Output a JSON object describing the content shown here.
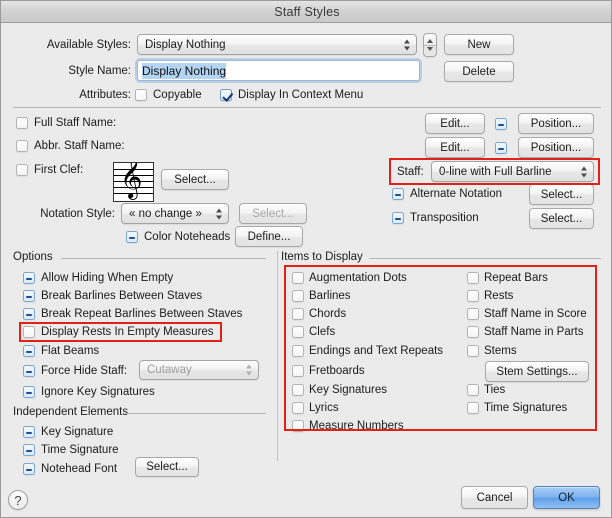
{
  "window": {
    "title": "Staff Styles"
  },
  "top": {
    "available_styles_label": "Available Styles:",
    "available_styles_value": "Display Nothing",
    "style_name_label": "Style Name:",
    "style_name_value": "Display Nothing",
    "attributes_label": "Attributes:",
    "copyable_label": "Copyable",
    "copyable_state": "off",
    "context_menu_label": "Display In Context Menu",
    "context_menu_state": "checked",
    "new_button": "New",
    "delete_button": "Delete",
    "stepper_name": "available-styles-stepper"
  },
  "staffinfo": {
    "full_staff_name_label": "Full Staff Name:",
    "full_staff_name_state": "off",
    "abbr_staff_name_label": "Abbr. Staff Name:",
    "abbr_staff_name_state": "off",
    "first_clef_label": "First Clef:",
    "first_clef_state": "off",
    "clef_glyph": "treble-clef",
    "clef_select_button": "Select...",
    "notation_style_label": "Notation Style:",
    "notation_style_value": "« no change »",
    "notation_select_button": "Select...",
    "color_noteheads_label": "Color Noteheads",
    "color_noteheads_state": "mixed",
    "define_button": "Define...",
    "edit_button_1": "Edit...",
    "position_button_1": "Position...",
    "edit_mixed_1": "mixed",
    "edit_button_2": "Edit...",
    "position_button_2": "Position...",
    "edit_mixed_2": "mixed",
    "staff_label": "Staff:",
    "staff_value": "0-line with Full Barline",
    "alternate_notation_label": "Alternate Notation",
    "alternate_notation_state": "mixed",
    "alternate_notation_button": "Select...",
    "transposition_label": "Transposition",
    "transposition_state": "mixed",
    "transposition_button": "Select..."
  },
  "options": {
    "group_label": "Options",
    "items": [
      {
        "label": "Allow Hiding When Empty",
        "state": "mixed"
      },
      {
        "label": "Break Barlines Between Staves",
        "state": "mixed"
      },
      {
        "label": "Break Repeat Barlines Between Staves",
        "state": "mixed"
      },
      {
        "label": "Display Rests In Empty Measures",
        "state": "off"
      },
      {
        "label": "Flat Beams",
        "state": "mixed"
      },
      {
        "label": "Force Hide Staff:",
        "state": "mixed"
      },
      {
        "label": "Ignore Key Signatures",
        "state": "mixed"
      }
    ],
    "force_hide_value": "Cutaway",
    "force_hide_disabled": true
  },
  "independent": {
    "group_label": "Independent Elements",
    "items": [
      {
        "label": "Key Signature",
        "state": "mixed"
      },
      {
        "label": "Time Signature",
        "state": "mixed"
      },
      {
        "label": "Notehead Font",
        "state": "mixed"
      }
    ],
    "notehead_select_button": "Select..."
  },
  "items_to_display": {
    "group_label": "Items to Display",
    "left_column": [
      {
        "label": "Augmentation Dots",
        "state": "off"
      },
      {
        "label": "Barlines",
        "state": "off"
      },
      {
        "label": "Chords",
        "state": "off"
      },
      {
        "label": "Clefs",
        "state": "off"
      },
      {
        "label": "Endings and Text Repeats",
        "state": "off"
      },
      {
        "label": "Fretboards",
        "state": "off"
      },
      {
        "label": "Key Signatures",
        "state": "off"
      },
      {
        "label": "Lyrics",
        "state": "off"
      },
      {
        "label": "Measure Numbers",
        "state": "off"
      }
    ],
    "right_column": [
      {
        "label": "Repeat Bars",
        "state": "off"
      },
      {
        "label": "Rests",
        "state": "off"
      },
      {
        "label": "Staff Name in Score",
        "state": "off"
      },
      {
        "label": "Staff Name in Parts",
        "state": "off"
      },
      {
        "label": "Stems",
        "state": "off"
      },
      {
        "label": "Ties",
        "state": "off"
      },
      {
        "label": "Time Signatures",
        "state": "off"
      }
    ],
    "stem_settings_button": "Stem Settings..."
  },
  "footer": {
    "help_label": "?",
    "cancel_button": "Cancel",
    "ok_button": "OK"
  },
  "annotations": {
    "highlight_color": "#e32119",
    "boxes": [
      "staff-popup-highlight",
      "display-rests-highlight",
      "items-to-display-highlight"
    ]
  }
}
